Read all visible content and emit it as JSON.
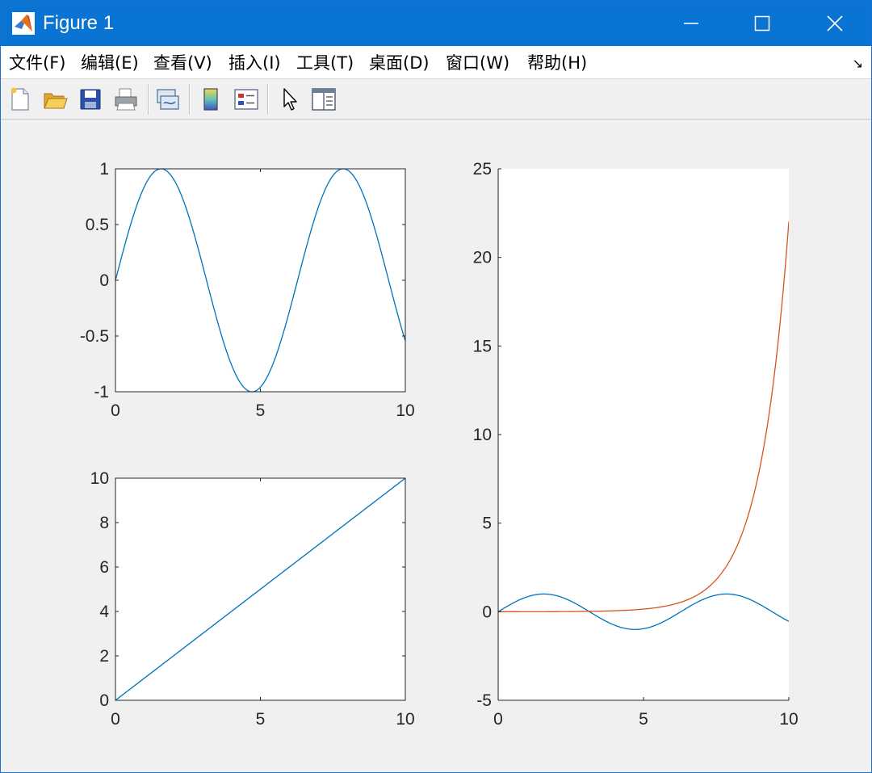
{
  "window": {
    "title": "Figure 1",
    "minimize_icon": "minimize-icon",
    "maximize_icon": "maximize-icon",
    "close_icon": "close-icon"
  },
  "menubar": {
    "items": [
      {
        "label": "文件(F)"
      },
      {
        "label": "编辑(E)"
      },
      {
        "label": "查看(V)"
      },
      {
        "label": "插入(I)"
      },
      {
        "label": "工具(T)"
      },
      {
        "label": "桌面(D)"
      },
      {
        "label": "窗口(W)"
      },
      {
        "label": "帮助(H)"
      }
    ],
    "dock_arrow": "↘"
  },
  "toolbar": {
    "buttons": [
      "new-figure-icon",
      "open-file-icon",
      "save-icon",
      "print-icon",
      "link-plot-icon",
      "insert-colorbar-icon",
      "insert-legend-icon",
      "edit-plot-arrow-icon",
      "property-inspector-icon"
    ]
  },
  "colors": {
    "title_bar": "#0a74d4",
    "series_blue": "#0072bd",
    "series_orange": "#d95319"
  },
  "chart_data": [
    {
      "type": "line",
      "title": "",
      "xlabel": "",
      "ylabel": "",
      "xlim": [
        0,
        10
      ],
      "ylim": [
        -1,
        1
      ],
      "xticks": [
        "0",
        "5",
        "10"
      ],
      "yticks": [
        "-1",
        "-0.5",
        "0",
        "0.5",
        "1"
      ],
      "series": [
        {
          "function": "sin(x)",
          "x": [
            0,
            1.5708,
            3.1416,
            4.7124,
            6.2832,
            7.854,
            9.4248,
            10
          ],
          "values": [
            0,
            1,
            0,
            -1,
            0,
            1,
            0,
            -0.544
          ],
          "color": "#0072bd"
        }
      ],
      "grid": false
    },
    {
      "type": "line",
      "title": "",
      "xlabel": "",
      "ylabel": "",
      "xlim": [
        0,
        10
      ],
      "ylim": [
        0,
        10
      ],
      "xticks": [
        "0",
        "5",
        "10"
      ],
      "yticks": [
        "0",
        "2",
        "4",
        "6",
        "8",
        "10"
      ],
      "series": [
        {
          "function": "x",
          "x": [
            0,
            10
          ],
          "values": [
            0,
            10
          ],
          "color": "#0072bd"
        }
      ],
      "grid": false
    },
    {
      "type": "line",
      "title": "",
      "xlabel": "",
      "ylabel": "",
      "xlim": [
        0,
        10
      ],
      "ylim": [
        -5,
        25
      ],
      "xticks": [
        "0",
        "5",
        "10"
      ],
      "yticks": [
        "-5",
        "0",
        "5",
        "10",
        "15",
        "20",
        "25"
      ],
      "series": [
        {
          "function": "sin(x)",
          "x": [
            0,
            1.5708,
            4.7124,
            7.854,
            10
          ],
          "values": [
            0,
            1,
            -1,
            1,
            -0.544
          ],
          "color": "#0072bd"
        },
        {
          "function": "exp(x)/1000",
          "x": [
            0,
            5,
            7,
            8,
            9,
            10
          ],
          "values": [
            0.001,
            0.148,
            1.097,
            2.981,
            8.103,
            22.026
          ],
          "color": "#d95319"
        }
      ],
      "grid": false
    }
  ]
}
